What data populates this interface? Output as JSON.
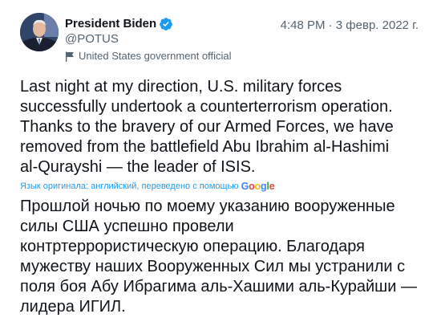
{
  "tweet": {
    "author": {
      "display_name": "President Biden",
      "handle": "@POTUS",
      "affiliation": "United States government official",
      "verified_icon": "verified-badge-icon",
      "affiliation_icon": "flag-icon"
    },
    "timestamp": "4:48 PM · 3 февр. 2022 г.",
    "text": "Last night at my direction, U.S. military forces\nsuccessfully undertook a counterterrorism operation.\nThanks to the bravery of our Armed Forces, we have\nremoved from the battlefield Abu Ibrahim al-Hashimi\nal-Qurayshi — the leader of ISIS.",
    "translation_note": "Язык оригинала: английский, переведено с помощью",
    "translation_provider": "Google",
    "translated_text": "Прошлой ночью по моему указанию вооруженные\nсилы США успешно провели\nконтртеррористическую операцию. Благодаря\nмужеству наших Вооруженных Сил мы устранили с\nполя боя Абу Ибрагима аль-Хашими аль-Курайши —\nлидера ИГИЛ."
  },
  "colors": {
    "primary_text": "#0f1419",
    "secondary_text": "#536471",
    "accent": "#1d9bf0"
  }
}
